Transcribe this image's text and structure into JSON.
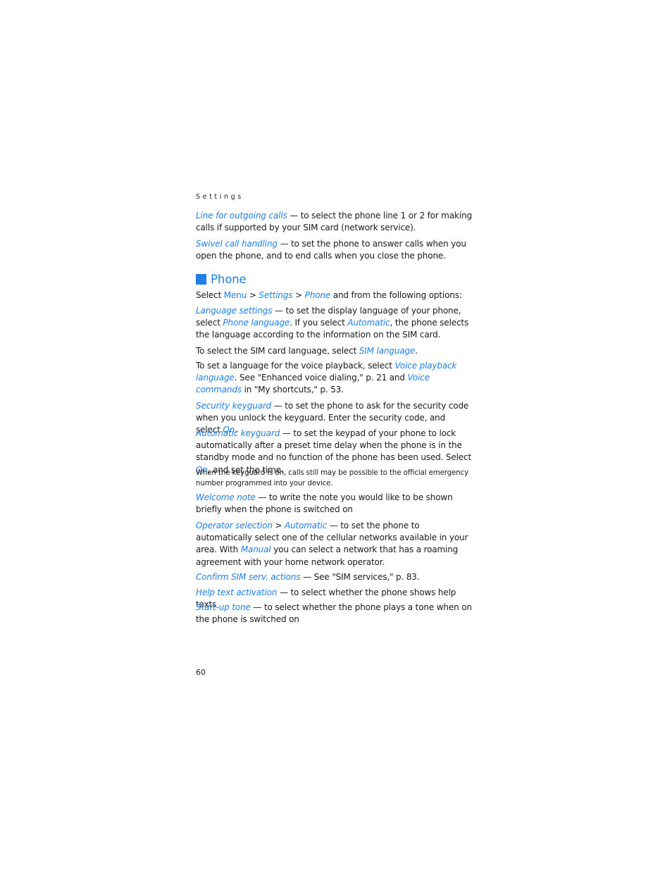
{
  "running_head": "Settings",
  "top_items": [
    {
      "term": "Line for outgoing calls",
      "text": " — to select the phone line 1 or 2 for making calls if supported by your SIM card (network service)."
    },
    {
      "term": "Swivel call handling",
      "text": " — to set the phone to answer calls when you open the phone, and to end calls when you close the phone."
    }
  ],
  "section": {
    "title": "Phone",
    "intro": {
      "pre": "Select ",
      "menu": "Menu",
      "sep1": " > ",
      "path1": "Settings",
      "sep2": " > ",
      "path2": "Phone",
      "post": " and from the following options:"
    },
    "language": {
      "term": "Language settings",
      "t1": " — to set the display language of your phone, select ",
      "opt1": "Phone language",
      "t2": ". If you select ",
      "opt2": "Automatic",
      "t3": ", the phone selects the language according to the information on the SIM card."
    },
    "sim_lang": {
      "pre": "To select the SIM card language, select ",
      "opt": "SIM language",
      "post": "."
    },
    "voice": {
      "pre": "To set a language for the voice playback, select ",
      "opt1": "Voice playback language",
      "mid": ". See \"Enhanced voice dialing,\" p. 21 and ",
      "opt2": "Voice commands",
      "post": " in \"My shortcuts,\" p. 53."
    },
    "security": {
      "term": "Security keyguard",
      "text": " — to set the phone to ask for the security code when you unlock the keyguard. Enter the security code, and select ",
      "opt": "On",
      "post": "."
    },
    "auto_keyguard": {
      "term": "Automatic keyguard",
      "text": " — to set the keypad of your phone to lock automatically after a preset time delay when the phone is in the standby mode and no function of the phone has been used. Select ",
      "opt": "On",
      "post": ", and set the time."
    },
    "note": "When the keyguard is on, calls still may be possible to the official emergency number programmed into your device.",
    "welcome": {
      "term": "Welcome note",
      "text": " — to write the note you would like to be shown briefly when the phone is switched on"
    },
    "operator": {
      "term": "Operator selection",
      "sep": " > ",
      "opt1": "Automatic",
      "text": " — to set the phone to automatically select one of the cellular networks available in your area. With ",
      "opt2": "Manual",
      "post": " you can select a network that has a roaming agreement with your home network operator."
    },
    "confirm": {
      "term": "Confirm SIM serv. actions",
      "text": " — See \"SIM services,\" p. 83."
    },
    "help": {
      "term": "Help text activation",
      "text": " — to select whether the phone shows help texts"
    },
    "startup": {
      "term": "Start-up tone",
      "text": " — to select whether the phone plays a tone when on the phone is switched on"
    }
  },
  "page_number": "60"
}
